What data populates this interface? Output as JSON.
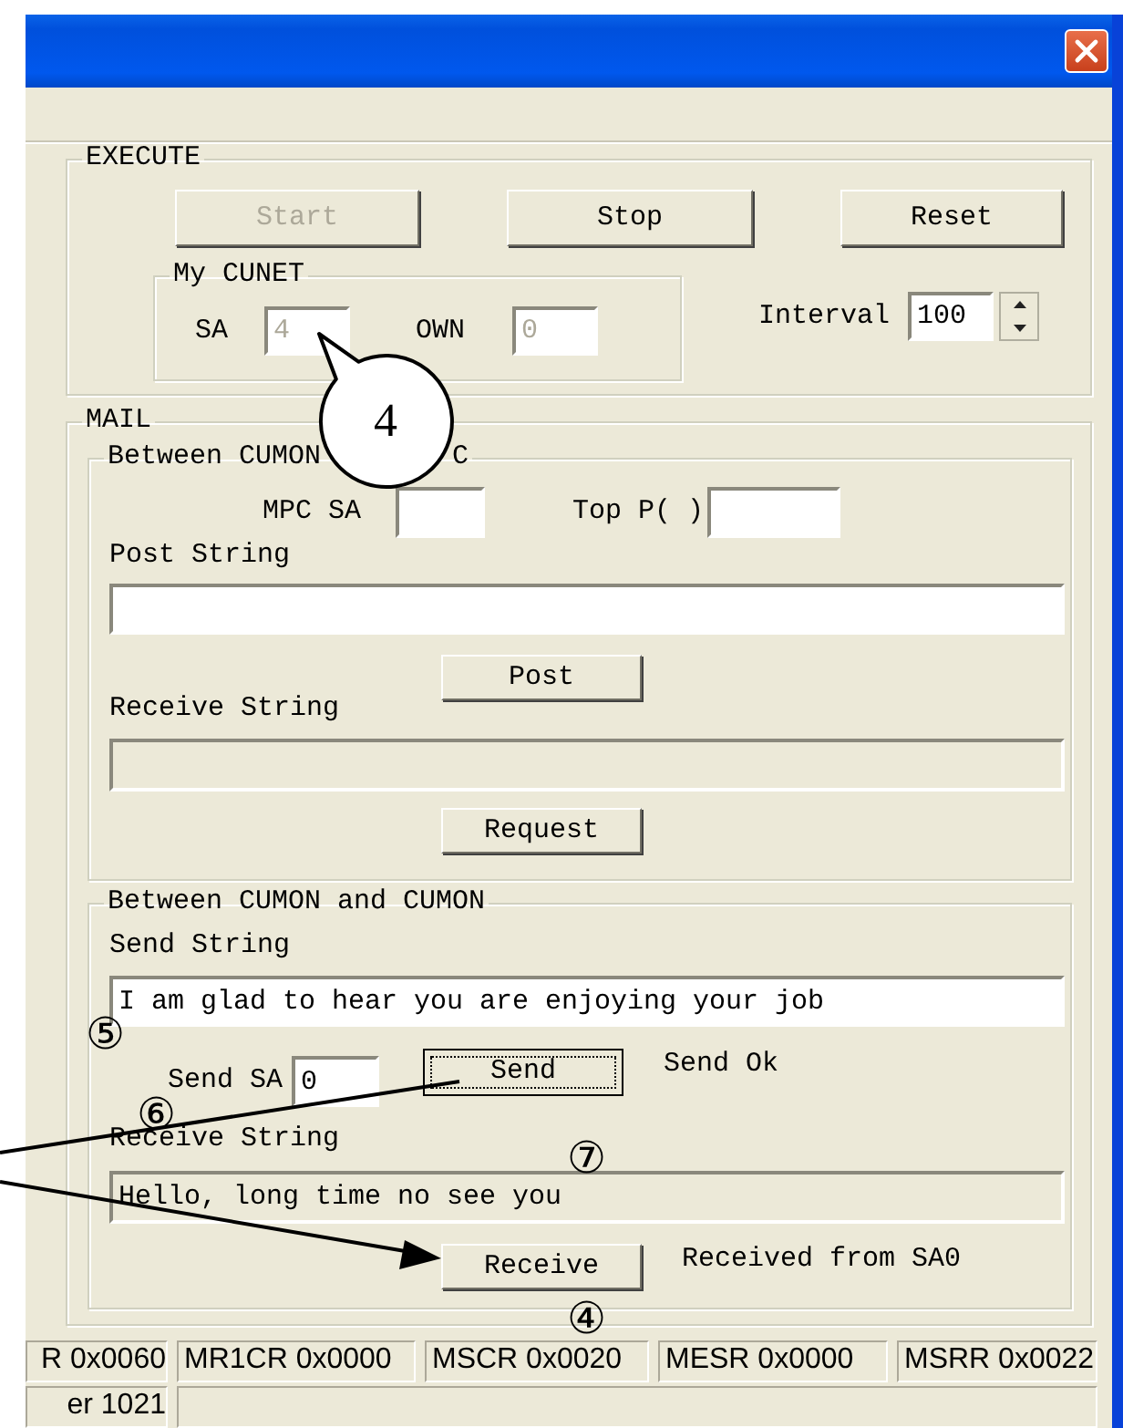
{
  "execute": {
    "title": "EXECUTE",
    "buttons": [
      {
        "label": "Start",
        "disabled": true
      },
      {
        "label": "Stop",
        "disabled": false
      },
      {
        "label": "Reset",
        "disabled": false
      }
    ],
    "my_cunet": {
      "title": "My CUNET",
      "fields": [
        {
          "label": "SA",
          "value": "4",
          "disabled": true
        },
        {
          "label": "OWN",
          "value": "0",
          "disabled": true
        }
      ]
    },
    "interval": {
      "label": "Interval",
      "value": "100"
    }
  },
  "mail": {
    "title": "MAIL",
    "mpc": {
      "title_parts": [
        "Between CUMON",
        "C"
      ],
      "mpc_sa": {
        "label": "MPC SA"
      },
      "top_p": {
        "label": "Top P( )"
      },
      "post_string": {
        "label": "Post String",
        "disabled": false
      },
      "post_button": {
        "label": "Post",
        "focused": false
      },
      "receive_string": {
        "label": "Receive String",
        "disabled": true
      },
      "request_button": {
        "label": "Request",
        "focused": false
      }
    },
    "cumon": {
      "title": "Between CUMON and CUMON",
      "send_string": {
        "label": "Send String",
        "value": "I am glad to hear you are enjoying your job",
        "disabled": false
      },
      "send_sa": {
        "label": "Send SA",
        "value": "0"
      },
      "send_button": {
        "label": "Send",
        "focused": true
      },
      "send_status": "Send Ok",
      "receive_string": {
        "label": "Receive String",
        "value": "Hello, long time no see you",
        "disabled": true
      },
      "receive_button": {
        "label": "Receive",
        "focused": false
      },
      "receive_status": "Received from SA0"
    }
  },
  "status_bar": {
    "rows": [
      [
        "R 0x0060",
        "MR1CR 0x0000",
        "MSCR 0x0020",
        "MESR 0x0000",
        "MSRR 0x0022"
      ],
      [
        "er 1021"
      ]
    ]
  },
  "annotations": [
    {
      "kind": "bubble",
      "label": "4"
    },
    {
      "kind": "circled",
      "label": "⑤"
    },
    {
      "kind": "circled",
      "label": "⑥"
    },
    {
      "kind": "circled",
      "label": "⑦"
    },
    {
      "kind": "circled",
      "label": "④"
    }
  ]
}
